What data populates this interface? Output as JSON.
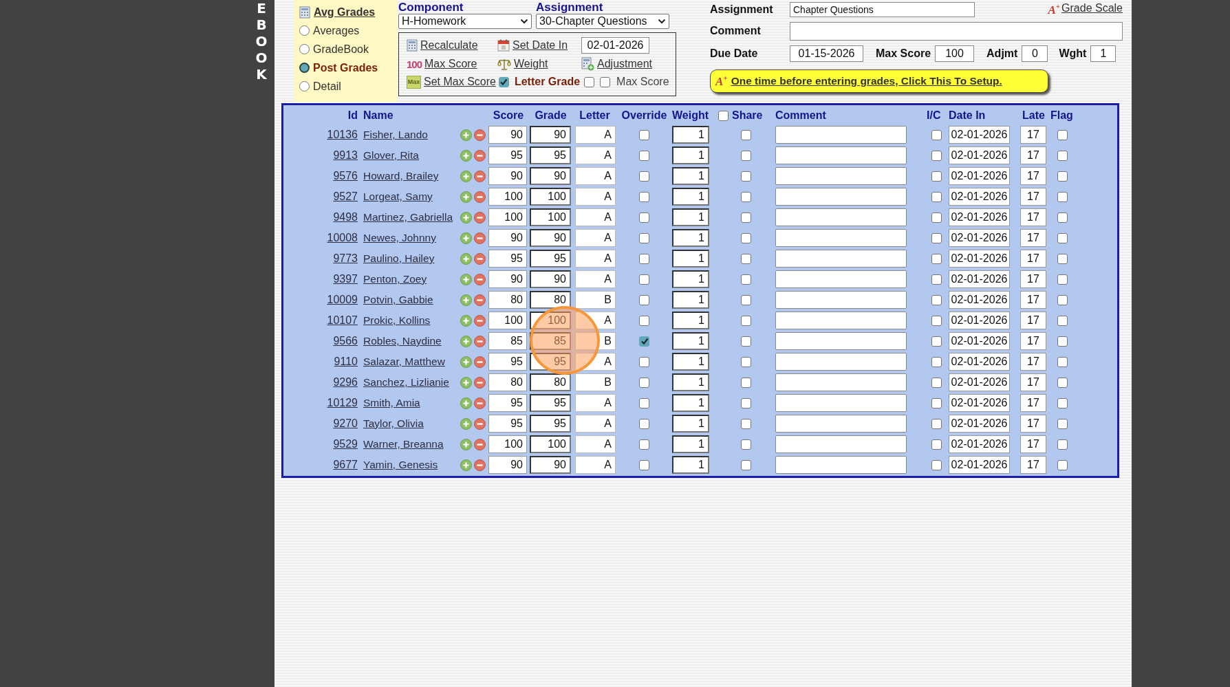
{
  "brand_letters": [
    "E",
    "B",
    "O",
    "O",
    "K"
  ],
  "menu": {
    "avg_link": "Avg Grades",
    "options": [
      {
        "label": "Averages",
        "selected": false
      },
      {
        "label": "GradeBook",
        "selected": false
      },
      {
        "label": "Post Grades",
        "selected": true
      },
      {
        "label": "Detail",
        "selected": false
      }
    ]
  },
  "selectors": {
    "component": {
      "label": "Component",
      "value": "H-Homework"
    },
    "assignment": {
      "label": "Assignment",
      "value": "30-Chapter Questions"
    }
  },
  "tools": {
    "recalculate": "Recalculate",
    "set_date_in": "Set Date In",
    "date_value": "02-01-2026",
    "max_score_badge": "100",
    "max_score": "Max Score",
    "weight": "Weight",
    "adjustment": "Adjustment",
    "set_max_badge": "Max",
    "set_max_score": "Set Max Score",
    "set_max_checked": true,
    "options": [
      {
        "label": "Letter Grade",
        "checked": false
      },
      {
        "label": "Max Score",
        "checked": false
      }
    ]
  },
  "assignment_form": {
    "assignment": {
      "label": "Assignment",
      "value": "Chapter Questions"
    },
    "grade_scale_icon": "A$^{+}$",
    "grade_scale": "Grade Scale",
    "comment": {
      "label": "Comment"
    },
    "due_date": {
      "label": "Due Date",
      "value": "01-15-2026"
    },
    "max_score": {
      "label": "Max Score",
      "value": "100"
    },
    "adjmt": {
      "label": "Adjmt",
      "value": "0"
    },
    "wght": {
      "label": "Wght",
      "value": "1"
    },
    "setup_icon": "A$^{+}$",
    "setup_button": "One time before entering grades, Click This To Setup."
  },
  "table": {
    "columns": [
      "Id",
      "Name",
      "Score",
      "Grade",
      "Letter",
      "Override",
      "Weight",
      "Share",
      "Comment",
      "I/C",
      "Date In",
      "Late",
      "Flag"
    ],
    "share_all_checked": false,
    "rows": [
      {
        "id": "10136",
        "name": "Fisher, Lando",
        "score": "90",
        "grade": "90",
        "letter": "A",
        "override": false,
        "weight": "1",
        "share": false,
        "ic": false,
        "date_in": "02-01-2026",
        "late": "17",
        "flag": false
      },
      {
        "id": "9913",
        "name": "Glover, Rita",
        "score": "95",
        "grade": "95",
        "letter": "A",
        "override": false,
        "weight": "1",
        "share": false,
        "ic": false,
        "date_in": "02-01-2026",
        "late": "17",
        "flag": false
      },
      {
        "id": "9576",
        "name": "Howard, Brailey",
        "score": "90",
        "grade": "90",
        "letter": "A",
        "override": false,
        "weight": "1",
        "share": false,
        "ic": false,
        "date_in": "02-01-2026",
        "late": "17",
        "flag": false
      },
      {
        "id": "9527",
        "name": "Lorgeat, Samy",
        "score": "100",
        "grade": "100",
        "letter": "A",
        "override": false,
        "weight": "1",
        "share": false,
        "ic": false,
        "date_in": "02-01-2026",
        "late": "17",
        "flag": false
      },
      {
        "id": "9498",
        "name": "Martinez, Gabriella",
        "score": "100",
        "grade": "100",
        "letter": "A",
        "override": false,
        "weight": "1",
        "share": false,
        "ic": false,
        "date_in": "02-01-2026",
        "late": "17",
        "flag": false
      },
      {
        "id": "10008",
        "name": "Newes, Johnny",
        "score": "90",
        "grade": "90",
        "letter": "A",
        "override": false,
        "weight": "1",
        "share": false,
        "ic": false,
        "date_in": "02-01-2026",
        "late": "17",
        "flag": false
      },
      {
        "id": "9773",
        "name": "Paulino, Hailey",
        "score": "95",
        "grade": "95",
        "letter": "A",
        "override": false,
        "weight": "1",
        "share": false,
        "ic": false,
        "date_in": "02-01-2026",
        "late": "17",
        "flag": false
      },
      {
        "id": "9397",
        "name": "Penton, Zoey",
        "score": "90",
        "grade": "90",
        "letter": "A",
        "override": false,
        "weight": "1",
        "share": false,
        "ic": false,
        "date_in": "02-01-2026",
        "late": "17",
        "flag": false
      },
      {
        "id": "10009",
        "name": "Potvin, Gabbie",
        "score": "80",
        "grade": "80",
        "letter": "B",
        "override": false,
        "weight": "1",
        "share": false,
        "ic": false,
        "date_in": "02-01-2026",
        "late": "17",
        "flag": false
      },
      {
        "id": "10107",
        "name": "Prokic, Kollins",
        "score": "100",
        "grade": "100",
        "letter": "A",
        "override": false,
        "weight": "1",
        "share": false,
        "ic": false,
        "date_in": "02-01-2026",
        "late": "17",
        "flag": false
      },
      {
        "id": "9566",
        "name": "Robles, Naydine",
        "score": "85",
        "grade": "85",
        "letter": "B",
        "override": true,
        "weight": "1",
        "share": false,
        "ic": false,
        "date_in": "02-01-2026",
        "late": "17",
        "flag": false
      },
      {
        "id": "9110",
        "name": "Salazar, Matthew",
        "score": "95",
        "grade": "95",
        "letter": "A",
        "override": false,
        "weight": "1",
        "share": false,
        "ic": false,
        "date_in": "02-01-2026",
        "late": "17",
        "flag": false
      },
      {
        "id": "9296",
        "name": "Sanchez, Lizlianie",
        "score": "80",
        "grade": "80",
        "letter": "B",
        "override": false,
        "weight": "1",
        "share": false,
        "ic": false,
        "date_in": "02-01-2026",
        "late": "17",
        "flag": false
      },
      {
        "id": "10129",
        "name": "Smith, Amia",
        "score": "95",
        "grade": "95",
        "letter": "A",
        "override": false,
        "weight": "1",
        "share": false,
        "ic": false,
        "date_in": "02-01-2026",
        "late": "17",
        "flag": false
      },
      {
        "id": "9270",
        "name": "Taylor, Olivia",
        "score": "95",
        "grade": "95",
        "letter": "A",
        "override": false,
        "weight": "1",
        "share": false,
        "ic": false,
        "date_in": "02-01-2026",
        "late": "17",
        "flag": false
      },
      {
        "id": "9529",
        "name": "Warner, Breanna",
        "score": "100",
        "grade": "100",
        "letter": "A",
        "override": false,
        "weight": "1",
        "share": false,
        "ic": false,
        "date_in": "02-01-2026",
        "late": "17",
        "flag": false
      },
      {
        "id": "9677",
        "name": "Yamin, Genesis",
        "score": "90",
        "grade": "90",
        "letter": "A",
        "override": false,
        "weight": "1",
        "share": false,
        "ic": false,
        "date_in": "02-01-2026",
        "late": "17",
        "flag": false
      }
    ]
  }
}
